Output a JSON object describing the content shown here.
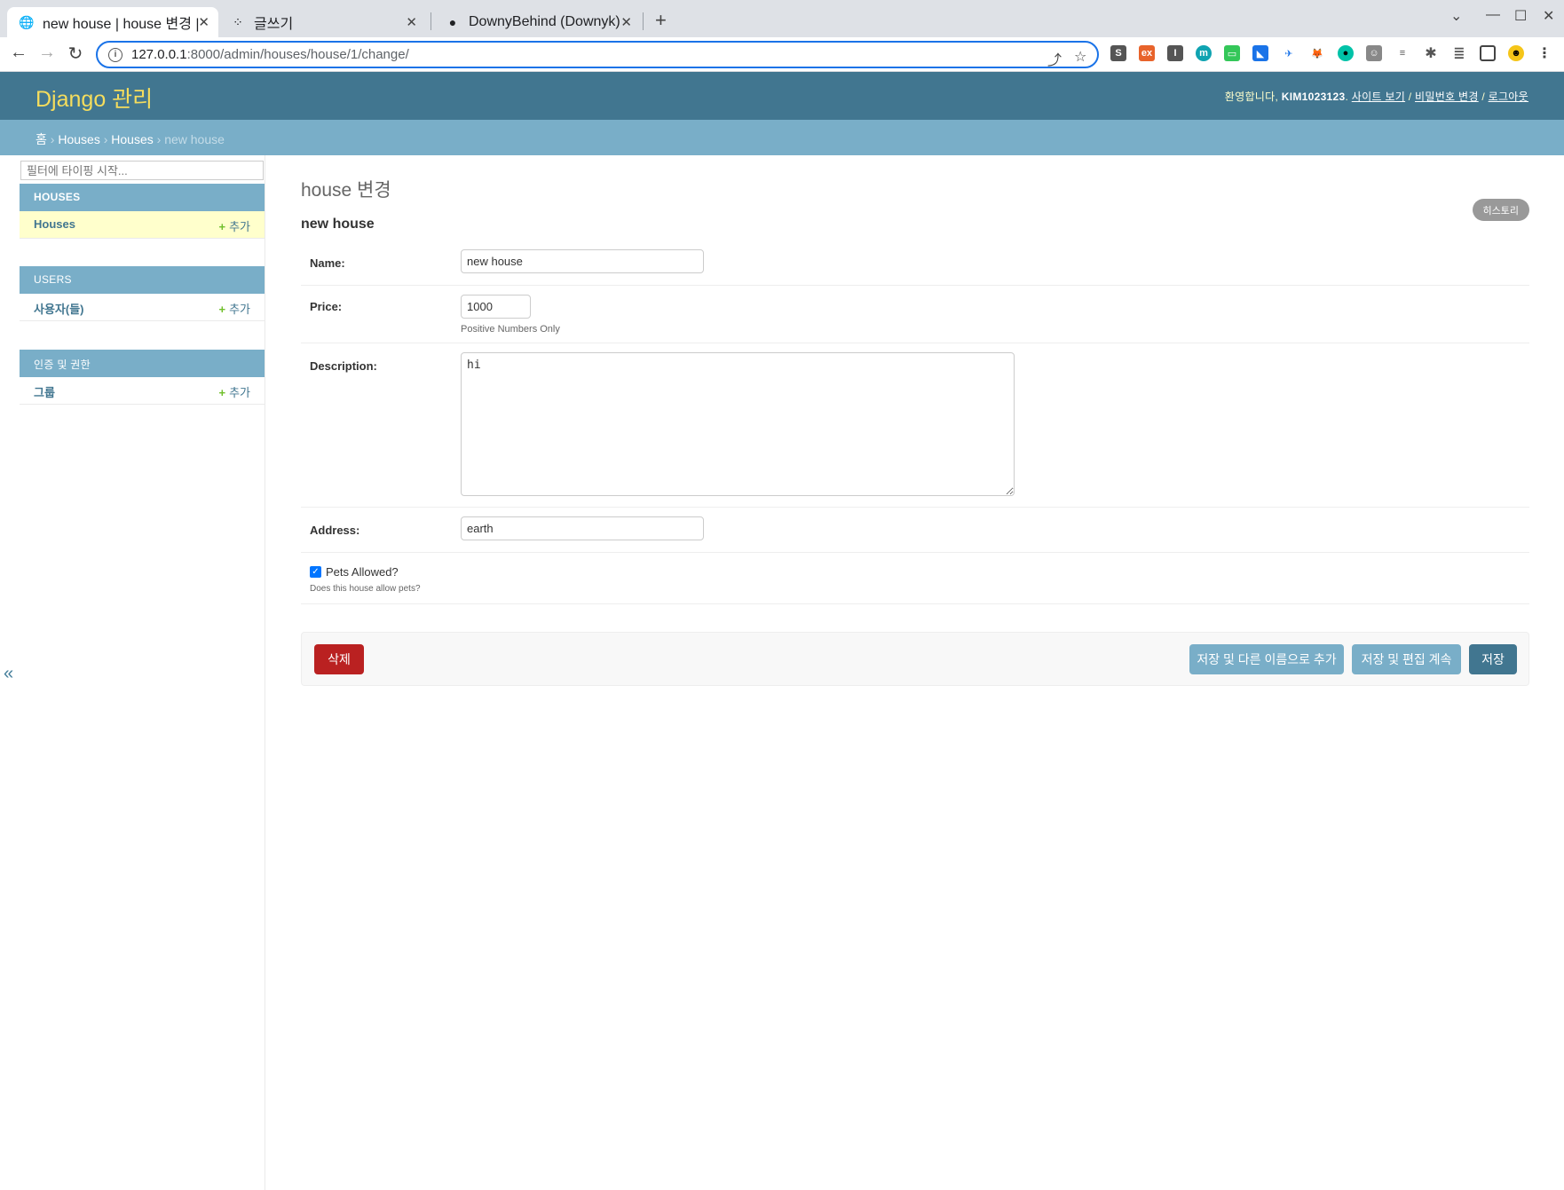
{
  "browser": {
    "tabs": [
      {
        "title": "new house | house 변경 | D",
        "icon": "globe-icon",
        "active": true
      },
      {
        "title": "글쓰기",
        "icon": "dots-icon",
        "active": false
      },
      {
        "title": "DownyBehind (Downyk)",
        "icon": "github-icon",
        "active": false
      }
    ],
    "url_host": "127.0.0.1",
    "url_path": ":8000/admin/houses/house/1/change/"
  },
  "header": {
    "branding": "Django 관리",
    "welcome": "환영합니다,",
    "username": "KIM1023123",
    "view_site": "사이트 보기",
    "change_password": "비밀번호 변경",
    "logout": "로그아웃",
    "separator": "/"
  },
  "breadcrumbs": {
    "home": "홈",
    "app": "Houses",
    "model": "Houses",
    "current": "new house",
    "sep": "›"
  },
  "sidebar": {
    "filter_placeholder": "필터에 타이핑 시작...",
    "add_label": "추가",
    "plus": "+",
    "collapse": "«",
    "modules": [
      {
        "caption": "HOUSES",
        "items": [
          {
            "name": "Houses"
          }
        ]
      },
      {
        "caption": "USERS",
        "items": [
          {
            "name": "사용자(들)"
          }
        ]
      },
      {
        "caption": "인증 및 권한",
        "items": [
          {
            "name": "그룹"
          }
        ]
      }
    ]
  },
  "main": {
    "title": "house 변경",
    "history": "히스토리",
    "object_name": "new house",
    "fields": {
      "name": {
        "label": "Name:",
        "value": "new house"
      },
      "price": {
        "label": "Price:",
        "value": "1000",
        "help": "Positive Numbers Only"
      },
      "description": {
        "label": "Description:",
        "value": "hi"
      },
      "address": {
        "label": "Address:",
        "value": "earth"
      },
      "pets": {
        "label": "Pets Allowed?",
        "checked": true,
        "help": "Does this house allow pets?"
      }
    },
    "buttons": {
      "delete": "삭제",
      "save_as_new": "저장 및 다른 이름으로 추가",
      "save_continue": "저장 및 편집 계속",
      "save": "저장"
    }
  },
  "colors": {
    "header": "#417690",
    "breadcrumb": "#79aec8",
    "branding": "#f5dd5d",
    "delete": "#ba2121"
  }
}
